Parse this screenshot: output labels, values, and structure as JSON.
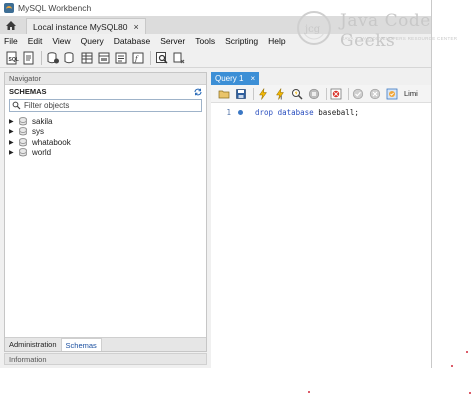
{
  "window": {
    "title": "MySQL Workbench"
  },
  "connection_tab": {
    "label": "Local instance MySQL80",
    "close": "×"
  },
  "menu": [
    "File",
    "Edit",
    "View",
    "Query",
    "Database",
    "Server",
    "Tools",
    "Scripting",
    "Help"
  ],
  "navigator": {
    "header": "Navigator",
    "schemas_title": "SCHEMAS",
    "filter_placeholder": "Filter objects",
    "schemas": [
      {
        "name": "sakila"
      },
      {
        "name": "sys"
      },
      {
        "name": "whatabook"
      },
      {
        "name": "world"
      }
    ],
    "bottom_tabs": [
      "Administration",
      "Schemas"
    ],
    "active_bottom_tab": "Schemas"
  },
  "information": {
    "label": "Information"
  },
  "editor": {
    "tab_label": "Query 1",
    "tab_close": "×",
    "limit_label": "Limi",
    "lines": [
      {
        "number": "1",
        "keyword1": "drop",
        "keyword2": "database",
        "identifier": "baseball;"
      }
    ]
  },
  "watermark": {
    "brand": "Java Code Geeks",
    "tagline": "JAVA 2 JAVA DEVELOPERS RESOURCE CENTER"
  },
  "colors": {
    "accent": "#3c8fd6",
    "keyword": "#2a4fbf",
    "watermark": "#c8c8c8",
    "dots": "#d1293a"
  }
}
